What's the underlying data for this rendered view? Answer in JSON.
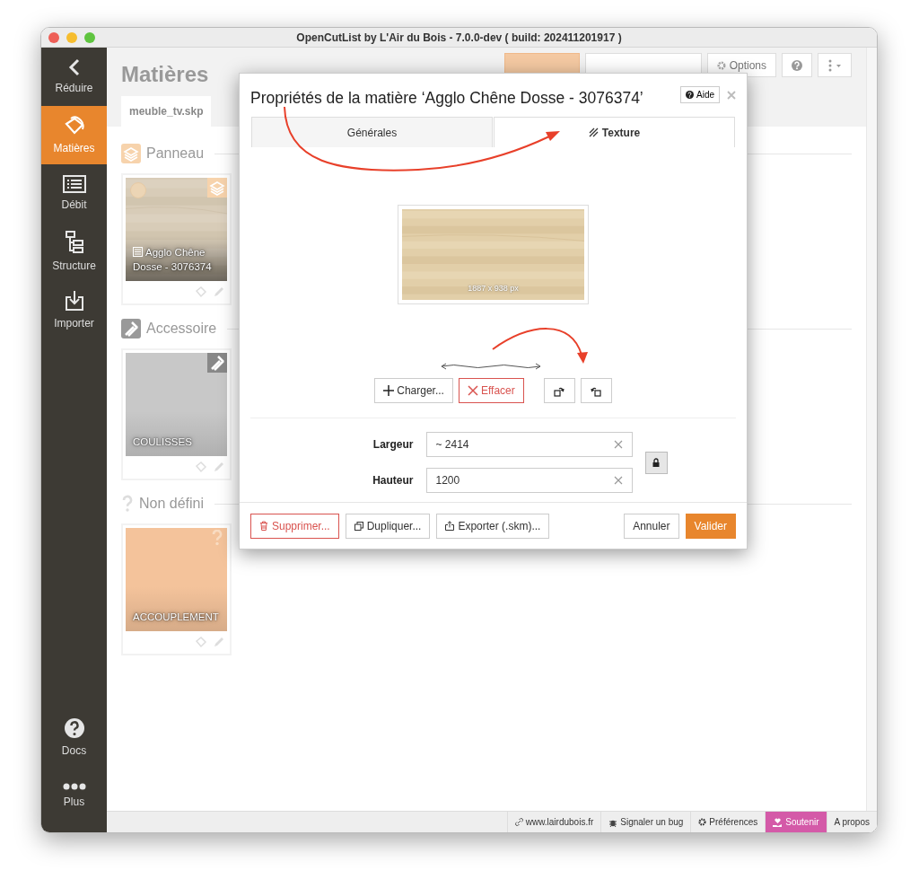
{
  "window": {
    "title": "OpenCutList by L'Air du Bois - 7.0.0-dev ( build: 202411201917 )"
  },
  "sidebar": {
    "items": [
      {
        "label": "Réduire",
        "selected": false
      },
      {
        "label": "Matières",
        "selected": true
      },
      {
        "label": "Débit",
        "selected": false
      },
      {
        "label": "Structure",
        "selected": false
      },
      {
        "label": "Importer",
        "selected": false
      }
    ],
    "bottom_items": [
      {
        "label": "Docs"
      },
      {
        "label": "Plus"
      }
    ]
  },
  "header": {
    "title": "Matières",
    "toolbar": [
      {
        "kind": "refresh"
      },
      {
        "kind": "new"
      },
      {
        "kind": "options",
        "label": "Options"
      },
      {
        "kind": "help"
      },
      {
        "kind": "more"
      }
    ]
  },
  "file_tabs": [
    {
      "label": "meuble_tv.skp",
      "selected": true
    }
  ],
  "groups": [
    {
      "title": "Panneau",
      "kind": "sheet",
      "materials": [
        {
          "name": "Agglo Chêne Dosse - 3076374",
          "kind": "texture"
        }
      ]
    },
    {
      "title": "Accessoire",
      "kind": "hardware",
      "materials": [
        {
          "name": "COULISSES",
          "kind": "color",
          "color": "#c8c8c8"
        }
      ]
    },
    {
      "title": "Non défini",
      "kind": "undefined",
      "materials": [
        {
          "name": "ACCOUPLEMENT",
          "kind": "color",
          "color": "#f4c39b"
        }
      ]
    }
  ],
  "dialog": {
    "title": "Propriétés de la matière ‘Agglo Chêne Dosse - 3076374’",
    "help_button": "Aide",
    "tabs": [
      {
        "label": "Générales",
        "selected": false
      },
      {
        "label": "Texture",
        "selected": true
      }
    ],
    "texture": {
      "size": "1887 x 938 px"
    },
    "actions": [
      {
        "kind": "load",
        "label": "Charger..."
      },
      {
        "kind": "clear",
        "label": "Effacer"
      },
      {
        "kind": "rotate-left"
      },
      {
        "kind": "rotate-right"
      }
    ],
    "fields": [
      {
        "label": "Largeur",
        "value": "~ 2414"
      },
      {
        "label": "Hauteur",
        "value": "1200"
      }
    ],
    "ratio_locked": true,
    "footer_left": [
      {
        "kind": "delete",
        "label": "Supprimer..."
      },
      {
        "kind": "duplicate",
        "label": "Dupliquer..."
      },
      {
        "kind": "export",
        "label": "Exporter (.skm)..."
      }
    ],
    "footer_right": [
      {
        "kind": "default",
        "label": "Annuler"
      },
      {
        "kind": "primary",
        "label": "Valider"
      }
    ]
  },
  "status_bar": [
    {
      "kind": "link",
      "label": "www.lairdubois.fr"
    },
    {
      "kind": "bug",
      "label": "Signaler un bug"
    },
    {
      "kind": "settings",
      "label": "Préférences"
    },
    {
      "kind": "support",
      "label": "Soutenir"
    },
    {
      "kind": "plain",
      "label": "A propos"
    }
  ]
}
